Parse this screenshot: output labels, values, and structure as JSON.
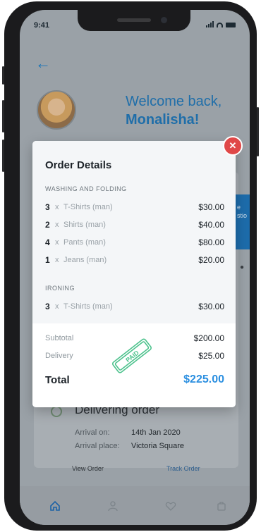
{
  "status": {
    "time": "9:41"
  },
  "header": {
    "welcome_line": "Welcome back,",
    "user_name": "Monalisha!"
  },
  "background": {
    "blue_panel_text": "e\nstio",
    "delivering": {
      "title": "Delivering order",
      "arrival_on_label": "Arrival on:",
      "arrival_on_value": "14th Jan 2020",
      "arrival_place_label": "Arrival place:",
      "arrival_place_value": "Victoria Square",
      "view_order_label": "View Order",
      "track_order_label": "Track Order"
    }
  },
  "modal": {
    "title": "Order Details",
    "close_label": "✕",
    "sections": [
      {
        "title": "WASHING AND FOLDING",
        "items": [
          {
            "qty": "3",
            "x": "x",
            "name": "T-Shirts (man)",
            "price": "$30.00"
          },
          {
            "qty": "2",
            "x": "x",
            "name": "Shirts (man)",
            "price": "$40.00"
          },
          {
            "qty": "4",
            "x": "x",
            "name": "Pants (man)",
            "price": "$80.00"
          },
          {
            "qty": "1",
            "x": "x",
            "name": "Jeans (man)",
            "price": "$20.00"
          }
        ]
      },
      {
        "title": "IRONING",
        "items": [
          {
            "qty": "3",
            "x": "x",
            "name": "T-Shirts (man)",
            "price": "$30.00"
          }
        ]
      }
    ],
    "subtotal_label": "Subtotal",
    "subtotal_value": "$200.00",
    "delivery_label": "Delivery",
    "delivery_value": "$25.00",
    "total_label": "Total",
    "total_value": "$225.00",
    "stamp_text": "PAID"
  },
  "nav": {
    "items": [
      {
        "icon": "home-icon",
        "active": true
      },
      {
        "icon": "user-icon",
        "active": false
      },
      {
        "icon": "heart-icon",
        "active": false
      },
      {
        "icon": "bag-icon",
        "active": false
      }
    ]
  },
  "colors": {
    "accent": "#2b8fe0",
    "close": "#e04848",
    "stamp": "#2fb87a"
  }
}
